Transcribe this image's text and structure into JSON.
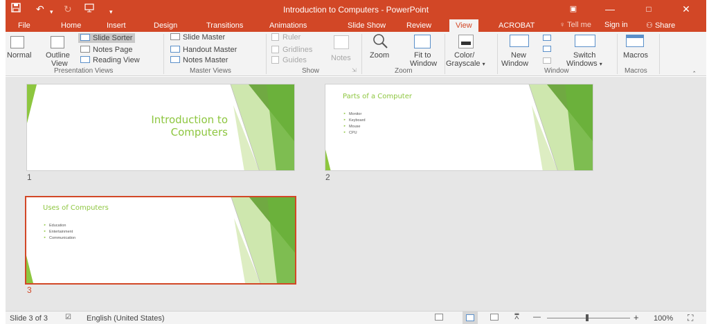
{
  "window": {
    "title": "Introduction to Computers - PowerPoint"
  },
  "quick_access": {
    "save_icon": "save-icon",
    "undo_icon": "undo-icon",
    "redo_icon": "redo-icon",
    "start_icon": "start-from-beginning-icon"
  },
  "tabs": [
    "File",
    "Home",
    "Insert",
    "Design",
    "Transitions",
    "Animations",
    "Slide Show",
    "Review",
    "View",
    "ACROBAT"
  ],
  "active_tab": "View",
  "tell_me": "Tell me",
  "sign_in": "Sign in",
  "share": "Share",
  "ribbon": {
    "presentation_views": {
      "label": "Presentation Views",
      "normal": "Normal",
      "outline_view_1": "Outline",
      "outline_view_2": "View",
      "slide_sorter": "Slide Sorter",
      "notes_page": "Notes Page",
      "reading_view": "Reading View"
    },
    "master_views": {
      "label": "Master Views",
      "slide_master": "Slide Master",
      "handout_master": "Handout Master",
      "notes_master": "Notes Master"
    },
    "show": {
      "label": "Show",
      "ruler": "Ruler",
      "gridlines": "Gridlines",
      "guides": "Guides",
      "notes": "Notes"
    },
    "zoom": {
      "label": "Zoom",
      "zoom": "Zoom",
      "fit_to_1": "Fit to",
      "fit_to_2": "Window"
    },
    "color": {
      "color_1": "Color/",
      "color_2": "Grayscale"
    },
    "window": {
      "label": "Window",
      "new_window_1": "New",
      "new_window_2": "Window",
      "switch_1": "Switch",
      "switch_2": "Windows"
    },
    "macros": {
      "label": "Macros",
      "macros": "Macros"
    }
  },
  "slides": [
    {
      "number": "1",
      "title_1": "Introduction to",
      "title_2": "Computers",
      "bullets": []
    },
    {
      "number": "2",
      "title": "Parts of a Computer",
      "bullets": [
        "Monitor",
        "Keyboard",
        "Mouse",
        "CPU"
      ]
    },
    {
      "number": "3",
      "title": "Uses of Computers",
      "bullets": [
        "Education",
        "Entertainment",
        "Communication"
      ]
    }
  ],
  "status": {
    "slide_info": "Slide 3 of 3",
    "language": "English (United States)",
    "zoom": "100%"
  },
  "colors": {
    "accent": "#d24726",
    "slide_green": "#8dc63f"
  }
}
